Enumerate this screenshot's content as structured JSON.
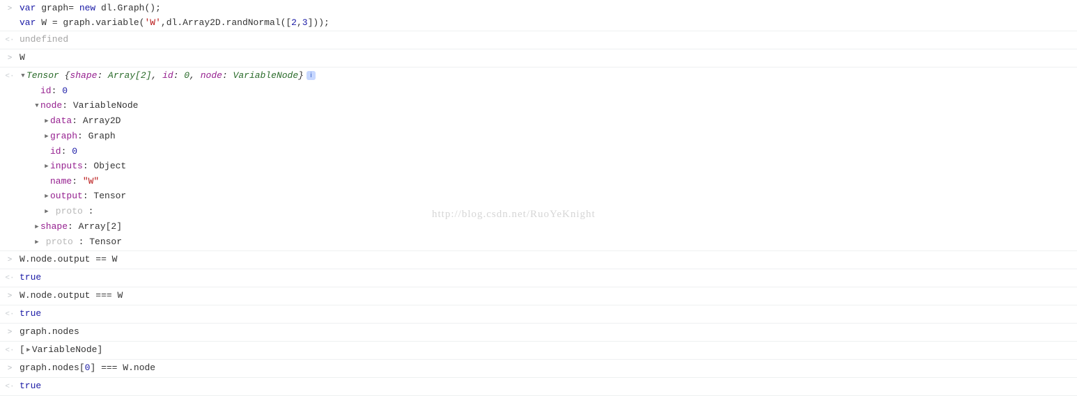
{
  "watermark": "http://blog.csdn.net/RuoYeKnight",
  "gutter": {
    "input": ">",
    "output": "<·"
  },
  "entries": [
    {
      "type": "input",
      "code_lines": [
        [
          {
            "cls": "kw",
            "t": "var"
          },
          {
            "cls": "nm",
            "t": " graph"
          },
          {
            "cls": "pn",
            "t": "= "
          },
          {
            "cls": "kw",
            "t": "new"
          },
          {
            "cls": "nm",
            "t": " dl"
          },
          {
            "cls": "pn",
            "t": "."
          },
          {
            "cls": "nm",
            "t": "Graph"
          },
          {
            "cls": "pn",
            "t": "();"
          }
        ],
        [
          {
            "cls": "kw",
            "t": "var"
          },
          {
            "cls": "nm",
            "t": " W "
          },
          {
            "cls": "pn",
            "t": "= "
          },
          {
            "cls": "nm",
            "t": "graph"
          },
          {
            "cls": "pn",
            "t": "."
          },
          {
            "cls": "nm",
            "t": "variable"
          },
          {
            "cls": "pn",
            "t": "("
          },
          {
            "cls": "str",
            "t": "'W'"
          },
          {
            "cls": "pn",
            "t": ","
          },
          {
            "cls": "nm",
            "t": "dl"
          },
          {
            "cls": "pn",
            "t": "."
          },
          {
            "cls": "nm",
            "t": "Array2D"
          },
          {
            "cls": "pn",
            "t": "."
          },
          {
            "cls": "nm",
            "t": "randNormal"
          },
          {
            "cls": "pn",
            "t": "(["
          },
          {
            "cls": "num",
            "t": "2"
          },
          {
            "cls": "pn",
            "t": ","
          },
          {
            "cls": "num",
            "t": "3"
          },
          {
            "cls": "pn",
            "t": "]));"
          }
        ]
      ]
    },
    {
      "type": "output_simple",
      "value_cls": "undef",
      "value": "undefined"
    },
    {
      "type": "input",
      "code_lines": [
        [
          {
            "cls": "nm",
            "t": "W"
          }
        ]
      ]
    },
    {
      "type": "output_obj",
      "header": {
        "type_name": "Tensor",
        "preview": [
          {
            "cls": "obj-brace",
            "t": " {"
          },
          {
            "cls": "prop",
            "t": "shape"
          },
          {
            "cls": "obj-brace",
            "t": ": "
          },
          {
            "cls": "obj-name",
            "t": "Array[2]"
          },
          {
            "cls": "obj-brace",
            "t": ", "
          },
          {
            "cls": "prop",
            "t": "id"
          },
          {
            "cls": "obj-brace",
            "t": ": "
          },
          {
            "cls": "obj-name",
            "t": "0"
          },
          {
            "cls": "obj-brace",
            "t": ", "
          },
          {
            "cls": "prop",
            "t": "node"
          },
          {
            "cls": "obj-brace",
            "t": ": "
          },
          {
            "cls": "obj-name",
            "t": "VariableNode"
          },
          {
            "cls": "obj-brace",
            "t": "}"
          }
        ],
        "info": "i"
      },
      "children": [
        {
          "indent": "indent1",
          "arrow": null,
          "prop": "id",
          "value": "0",
          "vcls": "num"
        },
        {
          "indent": "indent1",
          "arrow": "down",
          "prop": "node",
          "value": "VariableNode",
          "vcls": "val-obj"
        },
        {
          "indent": "indent2",
          "arrow": "right",
          "prop": "data",
          "value": "Array2D",
          "vcls": "val-obj"
        },
        {
          "indent": "indent2",
          "arrow": "right",
          "prop": "graph",
          "value": "Graph",
          "vcls": "val-obj"
        },
        {
          "indent": "indent2",
          "arrow": null,
          "prop": "id",
          "value": "0",
          "vcls": "num"
        },
        {
          "indent": "indent2",
          "arrow": "right",
          "prop": "inputs",
          "value": "Object",
          "vcls": "val-obj"
        },
        {
          "indent": "indent2",
          "arrow": null,
          "prop": "name",
          "value": "\"W\"",
          "vcls": "val-str"
        },
        {
          "indent": "indent2",
          "arrow": "right",
          "prop": "output",
          "value": "Tensor",
          "vcls": "val-obj"
        },
        {
          "indent": "indent2",
          "arrow": "right",
          "prop_cls": "proto",
          "prop": " proto ",
          "value": ":",
          "raw": true
        },
        {
          "indent": "indent1",
          "arrow": "right",
          "prop": "shape",
          "value": "Array[2]",
          "vcls": "val-obj"
        },
        {
          "indent": "indent1",
          "arrow": "right",
          "prop_cls": "proto",
          "prop": " proto ",
          "value": ": Tensor",
          "raw": true
        }
      ]
    },
    {
      "type": "input",
      "code_lines": [
        [
          {
            "cls": "nm",
            "t": "W"
          },
          {
            "cls": "pn",
            "t": "."
          },
          {
            "cls": "nm",
            "t": "node"
          },
          {
            "cls": "pn",
            "t": "."
          },
          {
            "cls": "nm",
            "t": "output "
          },
          {
            "cls": "pn",
            "t": "== "
          },
          {
            "cls": "nm",
            "t": "W"
          }
        ]
      ]
    },
    {
      "type": "output_simple",
      "value_cls": "bool",
      "value": "true"
    },
    {
      "type": "input",
      "code_lines": [
        [
          {
            "cls": "nm",
            "t": "W"
          },
          {
            "cls": "pn",
            "t": "."
          },
          {
            "cls": "nm",
            "t": "node"
          },
          {
            "cls": "pn",
            "t": "."
          },
          {
            "cls": "nm",
            "t": "output "
          },
          {
            "cls": "pn",
            "t": "=== "
          },
          {
            "cls": "nm",
            "t": "W"
          }
        ]
      ]
    },
    {
      "type": "output_simple",
      "value_cls": "bool",
      "value": "true"
    },
    {
      "type": "input",
      "code_lines": [
        [
          {
            "cls": "nm",
            "t": "graph"
          },
          {
            "cls": "pn",
            "t": "."
          },
          {
            "cls": "nm",
            "t": "nodes"
          }
        ]
      ]
    },
    {
      "type": "output_array",
      "items": [
        {
          "name": "VariableNode"
        }
      ]
    },
    {
      "type": "input",
      "code_lines": [
        [
          {
            "cls": "nm",
            "t": "graph"
          },
          {
            "cls": "pn",
            "t": "."
          },
          {
            "cls": "nm",
            "t": "nodes"
          },
          {
            "cls": "pn",
            "t": "["
          },
          {
            "cls": "num",
            "t": "0"
          },
          {
            "cls": "pn",
            "t": "] === "
          },
          {
            "cls": "nm",
            "t": "W"
          },
          {
            "cls": "pn",
            "t": "."
          },
          {
            "cls": "nm",
            "t": "node"
          }
        ]
      ]
    },
    {
      "type": "output_simple",
      "value_cls": "bool",
      "value": "true"
    }
  ]
}
